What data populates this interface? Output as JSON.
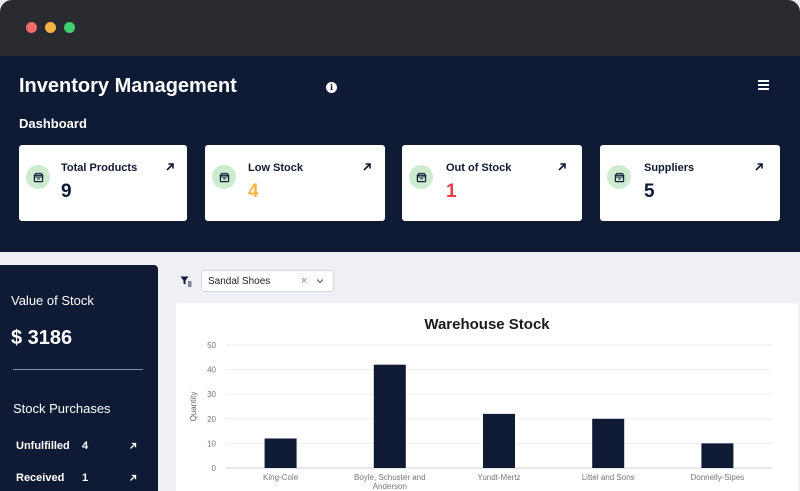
{
  "window": {
    "controls": [
      "close",
      "minimize",
      "maximize"
    ]
  },
  "header": {
    "title": "Inventory Management",
    "subtitle": "Dashboard",
    "info_icon": "info-icon",
    "menu_icon": "hamburger-menu-icon"
  },
  "cards": [
    {
      "label": "Total Products",
      "value": "9",
      "color": "#0f1a35"
    },
    {
      "label": "Low Stock",
      "value": "4",
      "color": "#f5b342"
    },
    {
      "label": "Out of Stock",
      "value": "1",
      "color": "#e53d4b"
    },
    {
      "label": "Suppliers",
      "value": "5",
      "color": "#0f1a35"
    }
  ],
  "sidebar": {
    "value_label": "Value of Stock",
    "value": "$ 3186",
    "purchases_label": "Stock Purchases",
    "rows": [
      {
        "label": "Unfulfilled",
        "count": "4"
      },
      {
        "label": "Received",
        "count": "1"
      }
    ]
  },
  "filter": {
    "selected": "Sandal Shoes"
  },
  "colors": {
    "primary": "#0f1a35",
    "accent_green": "#cdeccf",
    "warning": "#f5b342",
    "danger": "#e53d4b"
  },
  "chart_data": {
    "type": "bar",
    "title": "Warehouse Stock",
    "ylabel": "Quantity",
    "xlabel": "",
    "categories": [
      "King-Cole",
      "Boyle, Schuster and Anderson",
      "Yundt-Mertz",
      "Littel and Sons",
      "Donnelly-Sipes"
    ],
    "category_lines": [
      [
        "King-Cole"
      ],
      [
        "Boyle, Schuster and",
        "Anderson"
      ],
      [
        "Yundt-Mertz"
      ],
      [
        "Littel and Sons"
      ],
      [
        "Donnelly-Sipes"
      ]
    ],
    "values": [
      12,
      42,
      22,
      20,
      10
    ],
    "ylim": [
      0,
      50
    ],
    "yticks": [
      0,
      10,
      20,
      30,
      40,
      50
    ],
    "grid": true,
    "bar_color": "#0f1a35"
  }
}
